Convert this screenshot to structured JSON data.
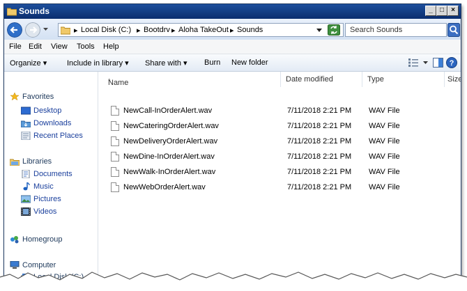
{
  "window": {
    "title": "Sounds"
  },
  "address": {
    "crumbs": [
      "Local Disk (C:)",
      "Bootdrv",
      "Aloha TakeOut",
      "Sounds"
    ],
    "search_placeholder": "Search Sounds"
  },
  "menu": [
    "File",
    "Edit",
    "View",
    "Tools",
    "Help"
  ],
  "commands": {
    "organize": "Organize",
    "include_in_library": "Include in library",
    "share_with": "Share with",
    "burn": "Burn",
    "new_folder": "New folder"
  },
  "nav": {
    "favorites": "Favorites",
    "desktop": "Desktop",
    "downloads": "Downloads",
    "recent_places": "Recent Places",
    "libraries": "Libraries",
    "documents": "Documents",
    "music": "Music",
    "pictures": "Pictures",
    "videos": "Videos",
    "homegroup": "Homegroup",
    "computer": "Computer",
    "local_disk": "Local Disk (C:)"
  },
  "columns": {
    "name": "Name",
    "date_modified": "Date modified",
    "type": "Type",
    "size": "Size"
  },
  "files": [
    {
      "name": "NewCall-InOrderAlert.wav",
      "date": "7/11/2018 2:21 PM",
      "type": "WAV File"
    },
    {
      "name": "NewCateringOrderAlert.wav",
      "date": "7/11/2018 2:21 PM",
      "type": "WAV File"
    },
    {
      "name": "NewDeliveryOrderAlert.wav",
      "date": "7/11/2018 2:21 PM",
      "type": "WAV File"
    },
    {
      "name": "NewDine-InOrderAlert.wav",
      "date": "7/11/2018 2:21 PM",
      "type": "WAV File"
    },
    {
      "name": "NewWalk-InOrderAlert.wav",
      "date": "7/11/2018 2:21 PM",
      "type": "WAV File"
    },
    {
      "name": "NewWebOrderAlert.wav",
      "date": "7/11/2018 2:21 PM",
      "type": "WAV File"
    }
  ],
  "colors": {
    "title_bar": "#0a2d6e",
    "link_blue": "#1a3f9c",
    "address_bar": "#d3e1f3"
  }
}
